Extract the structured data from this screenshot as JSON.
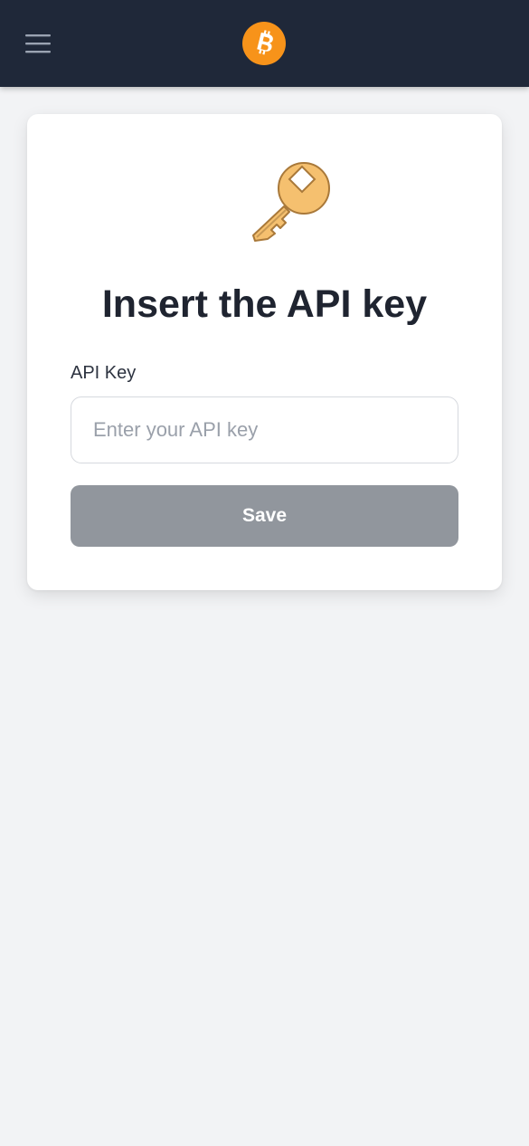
{
  "header": {
    "menu_icon": "hamburger-menu-icon",
    "logo_icon": "bitcoin-logo-icon",
    "logo_color": "#f7931a",
    "background_color": "#1f2839"
  },
  "card": {
    "icon": "key-icon",
    "icon_color": "#f5c06f",
    "title": "Insert the API key",
    "field_label": "API Key",
    "input_value": "",
    "input_placeholder": "Enter your API key",
    "save_label": "Save",
    "save_button_color": "#91969d"
  }
}
